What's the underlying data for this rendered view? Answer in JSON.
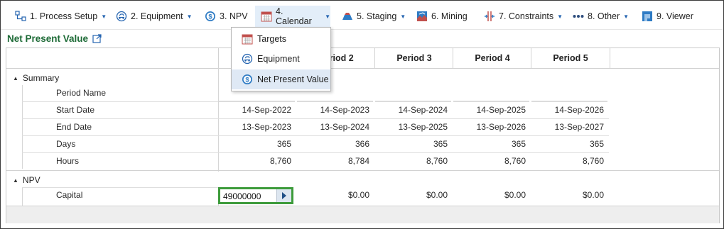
{
  "toolbar": {
    "items": [
      {
        "label": "1. Process Setup",
        "icon": "process-setup-icon"
      },
      {
        "label": "2. Equipment",
        "icon": "equipment-icon"
      },
      {
        "label": "3. NPV",
        "icon": "dollar-icon"
      },
      {
        "label": "4. Calendar",
        "icon": "calendar-icon"
      },
      {
        "label": "5. Staging",
        "icon": "staging-icon"
      },
      {
        "label": "6. Mining",
        "icon": "mining-icon"
      },
      {
        "label": "7. Constraints",
        "icon": "constraints-icon"
      },
      {
        "label": "8. Other",
        "icon": "more-dots-icon"
      },
      {
        "label": "9. Viewer",
        "icon": "viewer-icon"
      }
    ]
  },
  "page": {
    "title": "Net Present Value"
  },
  "calendar_menu": {
    "items": [
      {
        "label": "Targets",
        "icon": "targets-icon"
      },
      {
        "label": "Equipment",
        "icon": "equipment-icon"
      },
      {
        "label": "Net Present Value",
        "icon": "dollar-icon"
      }
    ]
  },
  "grid": {
    "columns": [
      "Period 2",
      "Period 3",
      "Period 4",
      "Period 5"
    ],
    "summary_label": "Summary",
    "rows": {
      "period_name": {
        "label": "Period Name"
      },
      "start_date": {
        "label": "Start Date",
        "values": [
          "14-Sep-2022",
          "14-Sep-2023",
          "14-Sep-2024",
          "14-Sep-2025",
          "14-Sep-2026"
        ]
      },
      "end_date": {
        "label": "End Date",
        "values": [
          "13-Sep-2023",
          "13-Sep-2024",
          "13-Sep-2025",
          "13-Sep-2026",
          "13-Sep-2027"
        ]
      },
      "days": {
        "label": "Days",
        "values": [
          "365",
          "366",
          "365",
          "365",
          "365"
        ]
      },
      "hours": {
        "label": "Hours",
        "values": [
          "8,760",
          "8,784",
          "8,760",
          "8,760",
          "8,760"
        ]
      }
    },
    "npv_label": "NPV",
    "capital": {
      "label": "Capital",
      "edit_value": "49000000",
      "values": [
        "$0.00",
        "$0.00",
        "$0.00",
        "$0.00"
      ]
    }
  }
}
